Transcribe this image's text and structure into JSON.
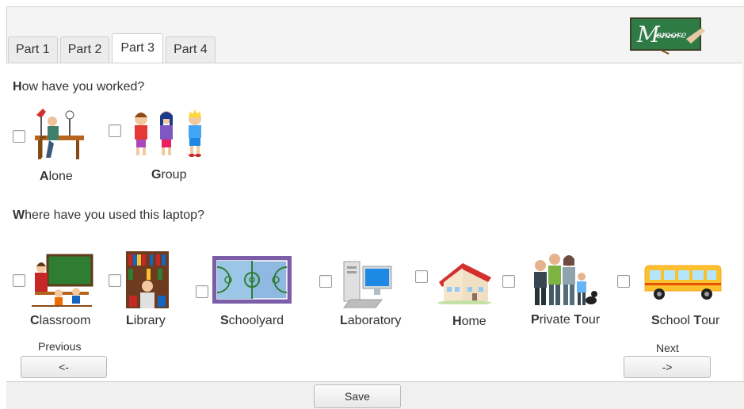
{
  "tabs": [
    "Part 1",
    "Part 2",
    "Part 3",
    "Part 4"
  ],
  "active_tab": "Part 3",
  "logo_text": "Memore",
  "question1": {
    "first": "H",
    "rest": "ow have you worked?"
  },
  "work_options": [
    {
      "first": "A",
      "rest": "lone"
    },
    {
      "first": "G",
      "rest": "roup"
    }
  ],
  "question2": {
    "first": "W",
    "rest": "here have you used this laptop?"
  },
  "place_options": [
    {
      "first": "C",
      "rest": "lassroom"
    },
    {
      "first": "L",
      "rest": "ibrary"
    },
    {
      "first": "S",
      "rest": "choolyard"
    },
    {
      "first": "L",
      "rest": "aboratory"
    },
    {
      "first": "H",
      "rest": "ome"
    },
    {
      "first": "P",
      "rest": "rivate ",
      "first2": "T",
      "rest2": "our"
    },
    {
      "first": "S",
      "rest": "chool ",
      "first2": "T",
      "rest2": "our"
    }
  ],
  "nav": {
    "previous_label": "Previous",
    "previous_button": "<-",
    "next_label": "Next",
    "next_button": "->"
  },
  "save_button": "Save"
}
